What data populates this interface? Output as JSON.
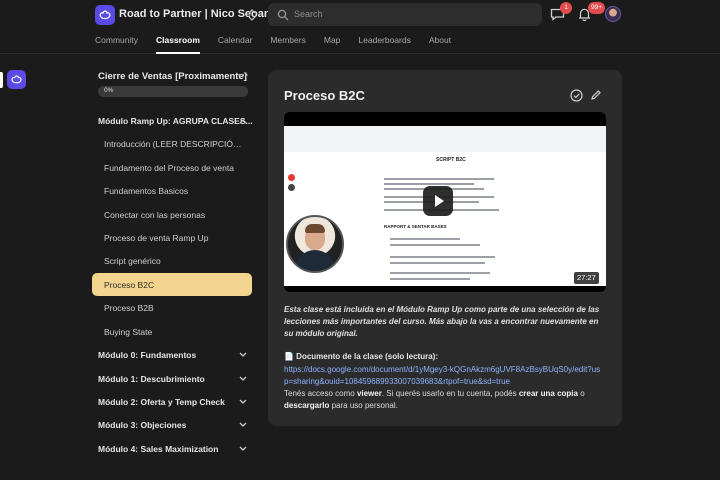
{
  "header": {
    "group_title": "Road to Partner | Nico Seoane",
    "search_placeholder": "Search",
    "chat_badge": "1",
    "notif_badge": "99+",
    "tabs": [
      {
        "label": "Community"
      },
      {
        "label": "Classroom"
      },
      {
        "label": "Calendar"
      },
      {
        "label": "Members"
      },
      {
        "label": "Map"
      },
      {
        "label": "Leaderboards"
      },
      {
        "label": "About"
      }
    ]
  },
  "sidebar": {
    "course_title": "Cierre de Ventas [Proximamente]",
    "progress_label": "0%",
    "progress_value": 0,
    "expanded_module": "Módulo Ramp Up: AGRUPA CLASES...",
    "lessons": [
      {
        "label": "Introducción (LEER DESCRIPCIÓN DEL ..."
      },
      {
        "label": "Fundamento del Proceso de venta"
      },
      {
        "label": "Fundamentos Basicos"
      },
      {
        "label": "Conectar con las personas"
      },
      {
        "label": "Proceso de venta Ramp Up"
      },
      {
        "label": "Script genérico"
      },
      {
        "label": "Proceso B2C"
      },
      {
        "label": "Proceso B2B"
      },
      {
        "label": "Buying State"
      }
    ],
    "modules": [
      {
        "label": "Módulo 0: Fundamentos"
      },
      {
        "label": "Módulo 1: Descubrimiento"
      },
      {
        "label": "Módulo 2: Oferta y Temp Check"
      },
      {
        "label": "Módulo 3: Objeciones"
      },
      {
        "label": "Módulo 4: Sales Maximization"
      }
    ]
  },
  "main": {
    "lesson_title": "Proceso B2C",
    "video": {
      "duration": "27:27",
      "doc_heading": "SCRIPT B2C",
      "doc_subheading": "RAPPORT & SENTAR BASES"
    },
    "description": "Esta clase está incluida en el Módulo Ramp Up como parte de una selección de las lecciones más importantes del curso. Más abajo la vas a encontrar nuevamente en su módulo original.",
    "doc_label": "📄 Documento de la clase (solo lectura):",
    "doc_url": "https://docs.google.com/document/d/1yMgey3-kQGnAkzm6gUVF8AzBsyBUqS0y/edit?usp=sharing&ouid=108459689933007039683&rtpof=true&sd=true",
    "access_text_1": "Tenés acceso como ",
    "access_viewer": "viewer",
    "access_text_2": ". Si querés usarlo en tu cuenta, podés ",
    "access_copy": "crear una copia",
    "access_text_3": " o ",
    "access_download": "descargarlo",
    "access_text_4": " para uso personal."
  },
  "colors": {
    "accent": "#5a4be6",
    "active_lesson": "#f4d58d",
    "badge": "#e34c4c",
    "link": "#8fb4ff"
  }
}
